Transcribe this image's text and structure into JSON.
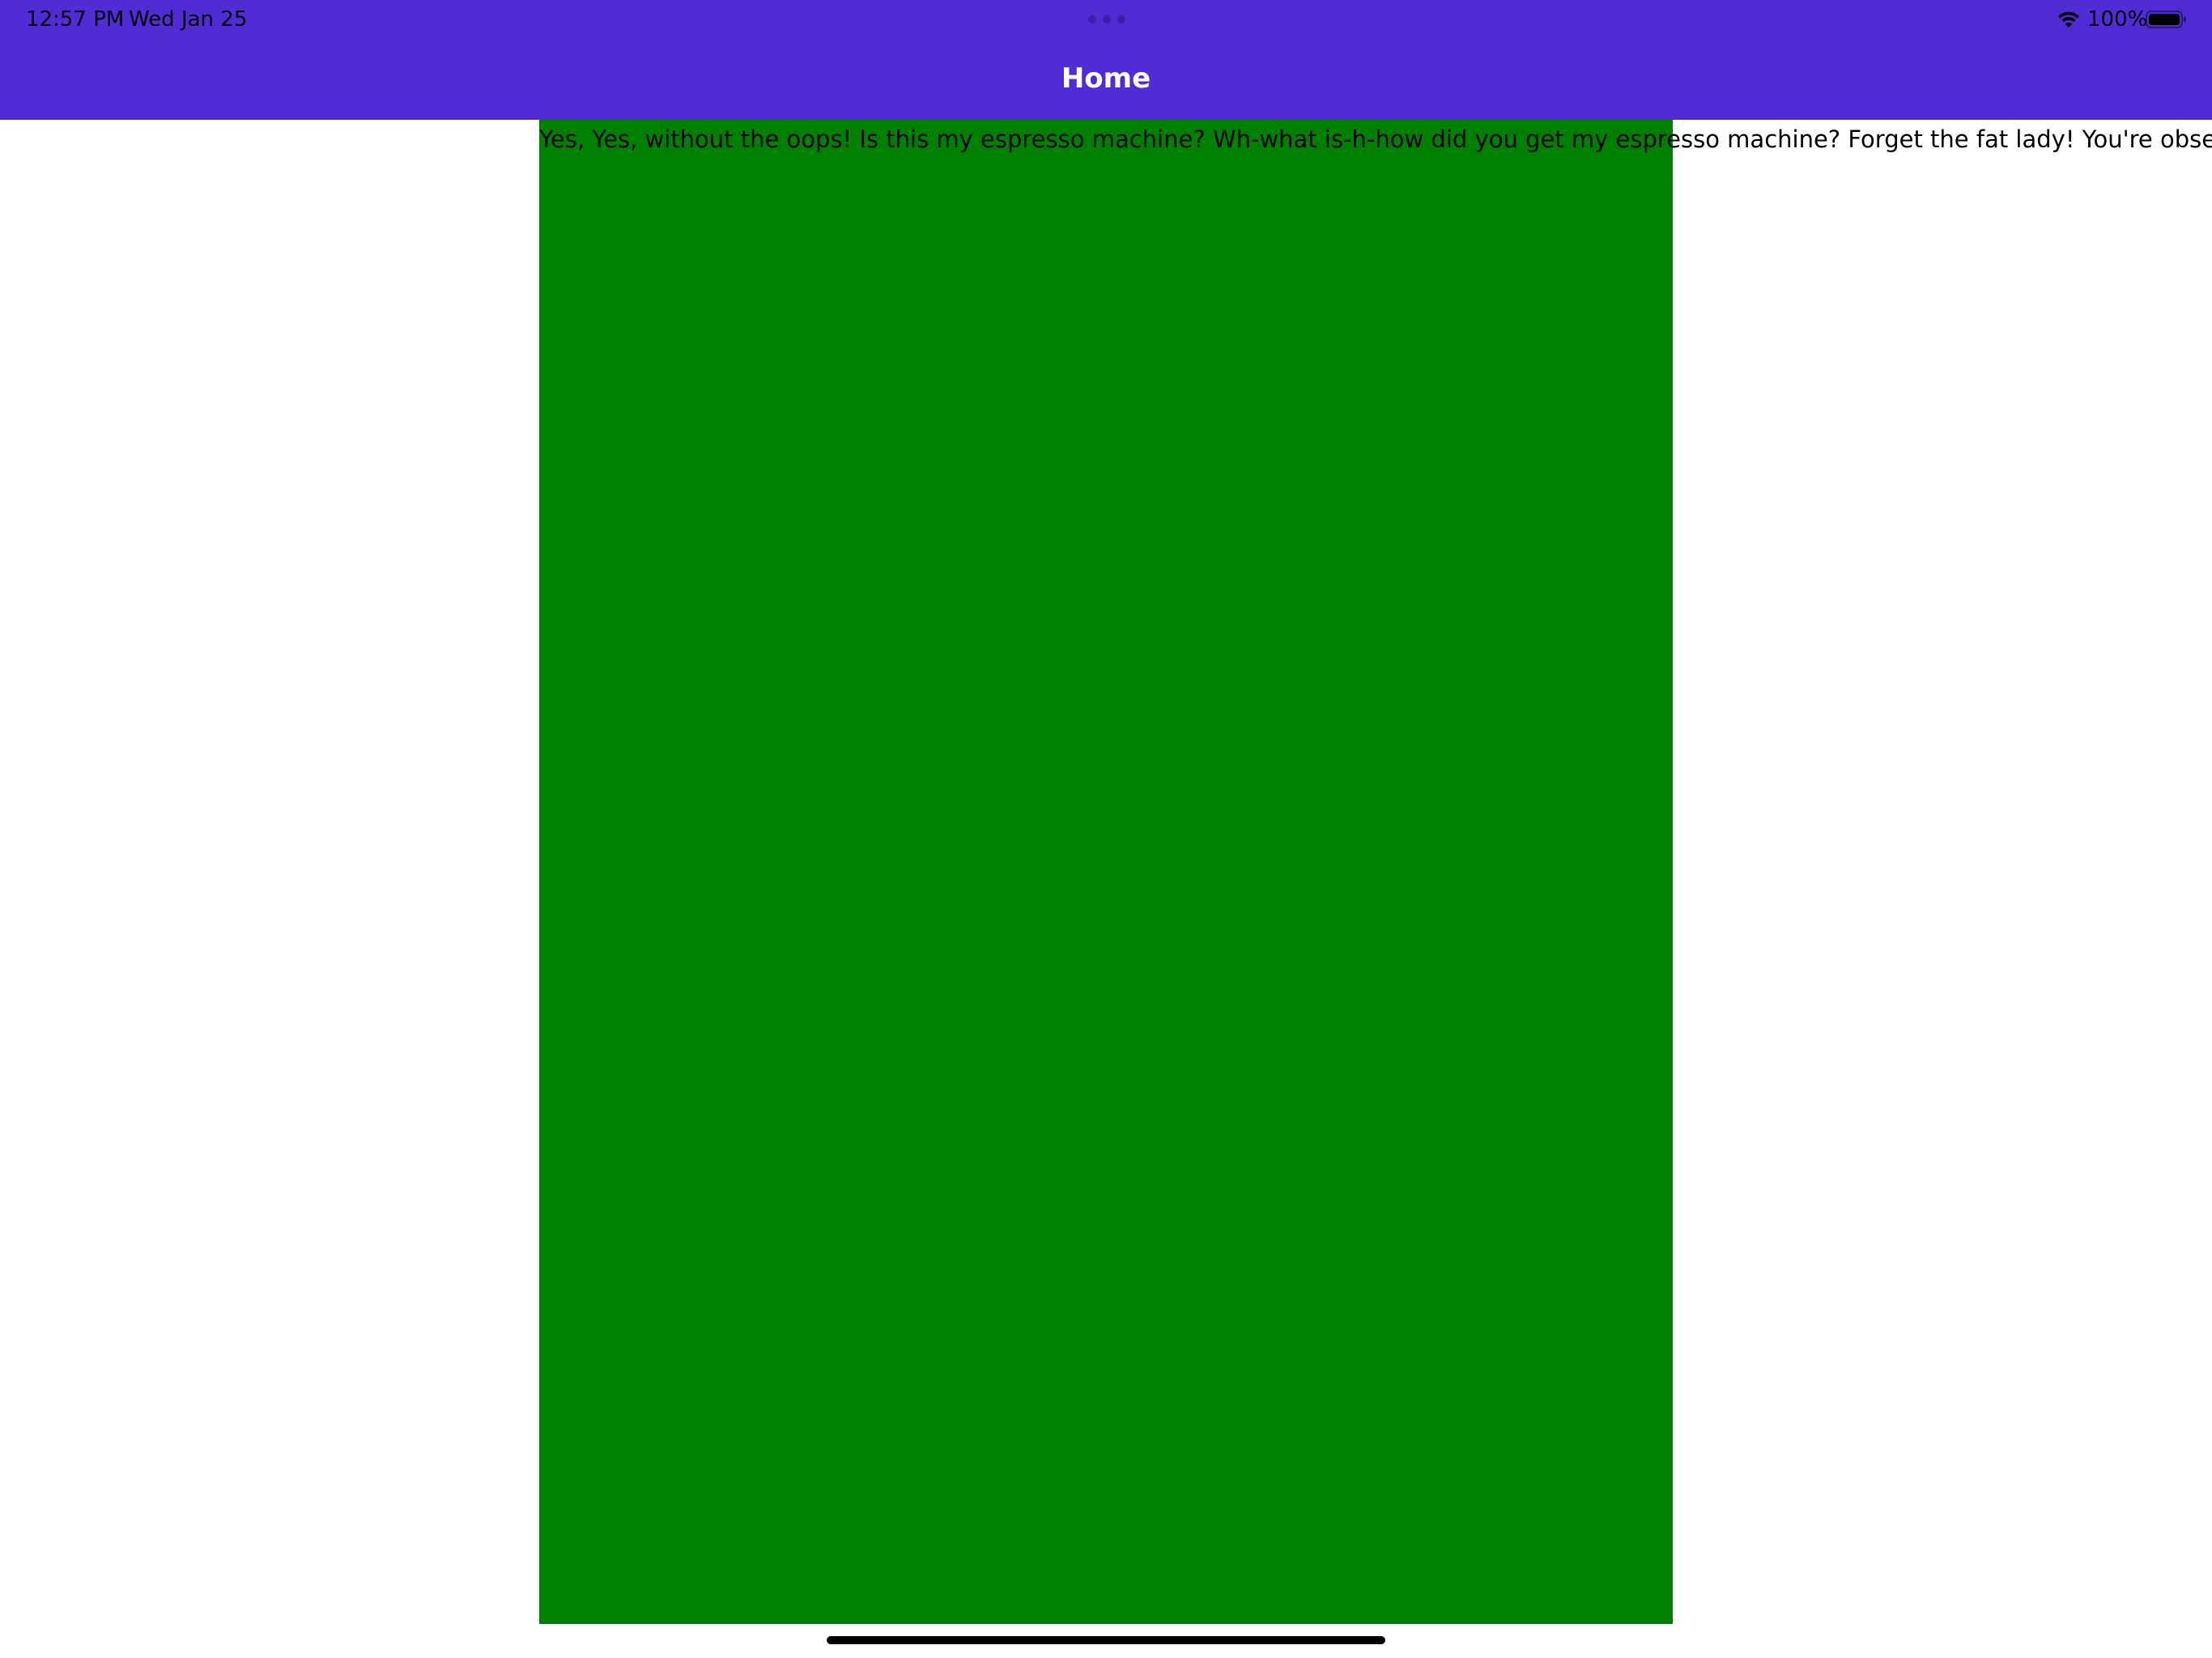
{
  "status_bar": {
    "time": "12:57 PM",
    "date": "Wed Jan 25",
    "battery_percent": "100%",
    "wifi_icon": "wifi-icon",
    "battery_icon": "battery-full-icon"
  },
  "nav": {
    "title": "Home"
  },
  "content": {
    "text": "Yes, Yes, without the oops! Is this my espresso machine? Wh-what is-h-how did you get my espresso machine? Forget the fat lady! You're obsessed with the fat",
    "box_color": "#008000"
  },
  "colors": {
    "header": "#512bd4",
    "background": "#ffffff"
  }
}
